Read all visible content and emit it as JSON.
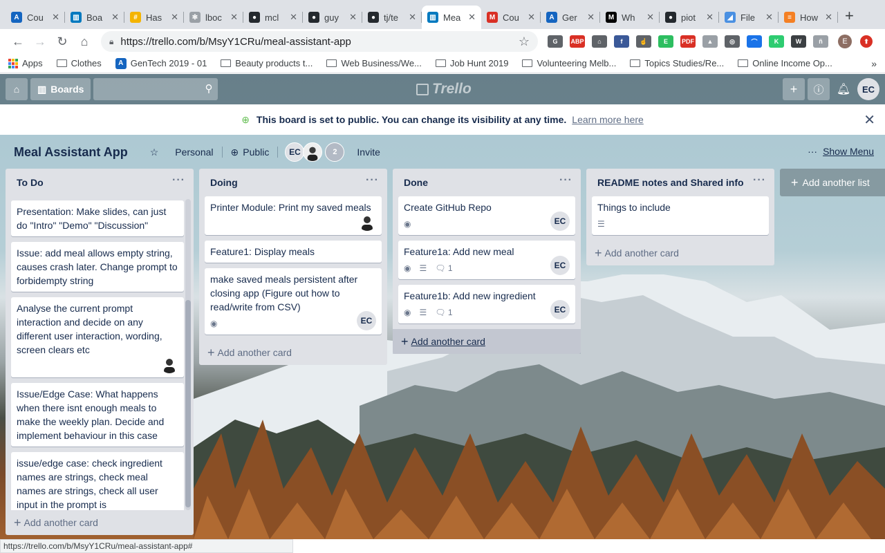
{
  "browser": {
    "tabs": [
      {
        "title": "Cou",
        "color": "#1565c0",
        "glyph": "A"
      },
      {
        "title": "Boa",
        "color": "#0079bf",
        "glyph": "▥"
      },
      {
        "title": "Has",
        "color": "#f4b400",
        "glyph": "#"
      },
      {
        "title": "lboc",
        "color": "#9aa0a6",
        "glyph": "✻"
      },
      {
        "title": "mcl",
        "color": "#24292e",
        "glyph": "●"
      },
      {
        "title": "guy",
        "color": "#24292e",
        "glyph": "●"
      },
      {
        "title": "tj/te",
        "color": "#24292e",
        "glyph": "●"
      },
      {
        "title": "Mea",
        "color": "#0079bf",
        "glyph": "▥",
        "active": true
      },
      {
        "title": "Cou",
        "color": "#d93025",
        "glyph": "M"
      },
      {
        "title": "Ger",
        "color": "#1565c0",
        "glyph": "A"
      },
      {
        "title": "Wh",
        "color": "#000000",
        "glyph": "M"
      },
      {
        "title": "piot",
        "color": "#24292e",
        "glyph": "●"
      },
      {
        "title": "File",
        "color": "#4a90e2",
        "glyph": "◢"
      },
      {
        "title": "How",
        "color": "#f48024",
        "glyph": "≡"
      }
    ],
    "new_tab": "+",
    "url": "https://trello.com/b/MsyY1CRu/meal-assistant-app",
    "extensions": [
      {
        "label": "G",
        "color": "#5f6368"
      },
      {
        "label": "ABP",
        "color": "#d93025"
      },
      {
        "label": "⌂",
        "color": "#5f6368"
      },
      {
        "label": "f",
        "color": "#3b5998"
      },
      {
        "label": "☝",
        "color": "#5f6368"
      },
      {
        "label": "E",
        "color": "#2dbe60"
      },
      {
        "label": "PDF",
        "color": "#d93025"
      },
      {
        "label": "▲",
        "color": "#9aa0a6"
      },
      {
        "label": "◎",
        "color": "#5f6368"
      },
      {
        "label": "⌒",
        "color": "#1a73e8"
      },
      {
        "label": "K",
        "color": "#2ecc71"
      },
      {
        "label": "W",
        "color": "#3c4043"
      },
      {
        "label": "ñ",
        "color": "#9aa0a6"
      }
    ],
    "profile_initial": "E",
    "bookmarks": [
      {
        "label": "Apps",
        "type": "apps"
      },
      {
        "label": "Clothes",
        "type": "folder"
      },
      {
        "label": "GenTech 2019 - 01",
        "type": "site"
      },
      {
        "label": "Beauty products t...",
        "type": "folder"
      },
      {
        "label": "Web Business/We...",
        "type": "folder"
      },
      {
        "label": "Job Hunt 2019",
        "type": "folder"
      },
      {
        "label": "Volunteering Melb...",
        "type": "folder"
      },
      {
        "label": "Topics Studies/Re...",
        "type": "folder"
      },
      {
        "label": "Online Income Op...",
        "type": "folder"
      }
    ],
    "bookmarks_more": "»",
    "status_url": "https://trello.com/b/MsyY1CRu/meal-assistant-app#"
  },
  "header": {
    "boards_label": "Boards",
    "logo_text": "Trello",
    "user_initials": "EC"
  },
  "banner": {
    "message": "This board is set to public. You can change its visibility at any time.",
    "link": "Learn more here"
  },
  "board": {
    "name": "Meal Assistant App",
    "team": "Personal",
    "visibility": "Public",
    "member_initials": "EC",
    "member_count": "2",
    "invite_label": "Invite",
    "show_menu_label": "Show Menu"
  },
  "lists": [
    {
      "title": "To Do",
      "add_label": "Add another card",
      "cards": [
        {
          "text": "Presentation: Make slides, can just do \"Intro\" \"Demo\" \"Discussion\""
        },
        {
          "text": "Issue: add meal allows empty string, causes crash later. Change prompt to forbidempty string"
        },
        {
          "text": "Analyse the current prompt interaction and decide on any different user interaction, wording, screen clears etc",
          "photo": true
        },
        {
          "text": "Issue/Edge Case: What happens when there isnt enough meals to make the weekly plan. Decide and implement behaviour in this case"
        },
        {
          "text": "issue/edge case: check ingredient names are strings, check meal names are strings, check all user input in the prompt is"
        }
      ]
    },
    {
      "title": "Doing",
      "add_label": "Add another card",
      "cards": [
        {
          "text": "Printer Module: Print my saved meals",
          "photo": true
        },
        {
          "text": "Feature1: Display meals"
        },
        {
          "text": "make saved meals persistent after closing app (Figure out how to read/write from CSV)",
          "watch": true,
          "member": "EC"
        }
      ]
    },
    {
      "title": "Done",
      "add_label": "Add another card",
      "cards": [
        {
          "text": "Create GitHub Repo",
          "watch": true,
          "member": "EC"
        },
        {
          "text": "Feature1a: Add new meal",
          "watch": true,
          "description": true,
          "comments": "1",
          "member": "EC"
        },
        {
          "text": "Feature1b: Add new ingredient",
          "watch": true,
          "description": true,
          "comments": "1",
          "member": "EC"
        }
      ]
    },
    {
      "title": "README notes and Shared info",
      "add_label": "Add another card",
      "cards": [
        {
          "text": "Things to include",
          "description": true
        }
      ]
    }
  ],
  "add_list_label": "Add another list"
}
